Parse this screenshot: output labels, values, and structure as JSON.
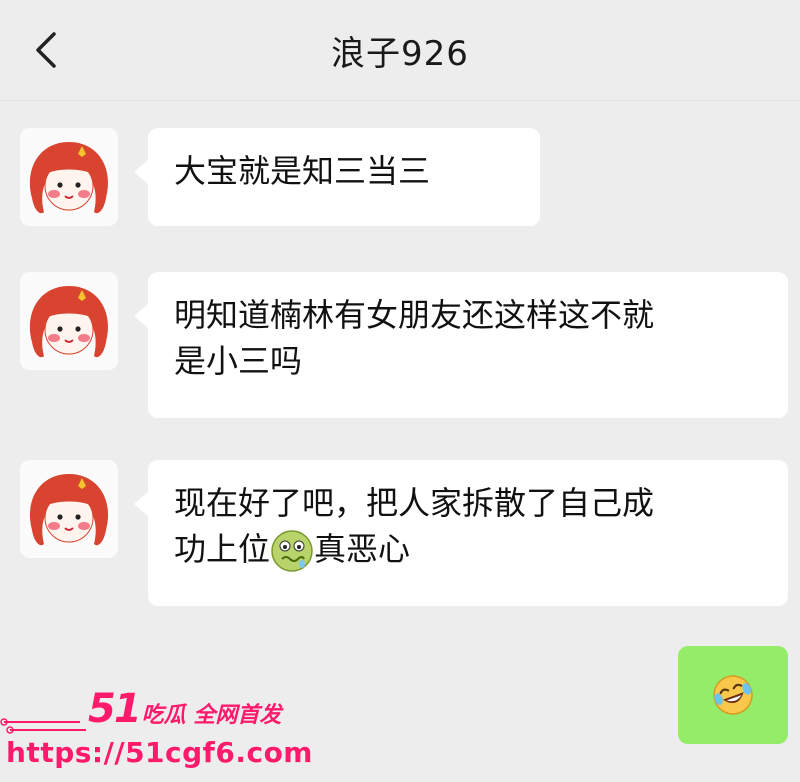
{
  "header": {
    "title": "浪子926",
    "back_icon": "chevron-left-icon"
  },
  "messages": [
    {
      "side": "left",
      "text": "大宝就是知三当三"
    },
    {
      "side": "left",
      "line1": "明知道楠林有女朋友还这样这不就",
      "line2": "是小三吗"
    },
    {
      "side": "left",
      "line1": "现在好了吧，把人家拆散了自己成",
      "line2_pre": "功上位",
      "emoji": "nauseated-face-icon",
      "line2_post": "真恶心"
    },
    {
      "side": "right",
      "emoji": "laughing-crying-face-icon"
    }
  ],
  "watermark": {
    "number": "51",
    "text": "吃瓜 全网首发",
    "url": "https://51cgf6.com"
  },
  "colors": {
    "background": "#ededed",
    "bubble_left": "#ffffff",
    "bubble_right": "#95ec69",
    "watermark": "#ff1a6b"
  }
}
